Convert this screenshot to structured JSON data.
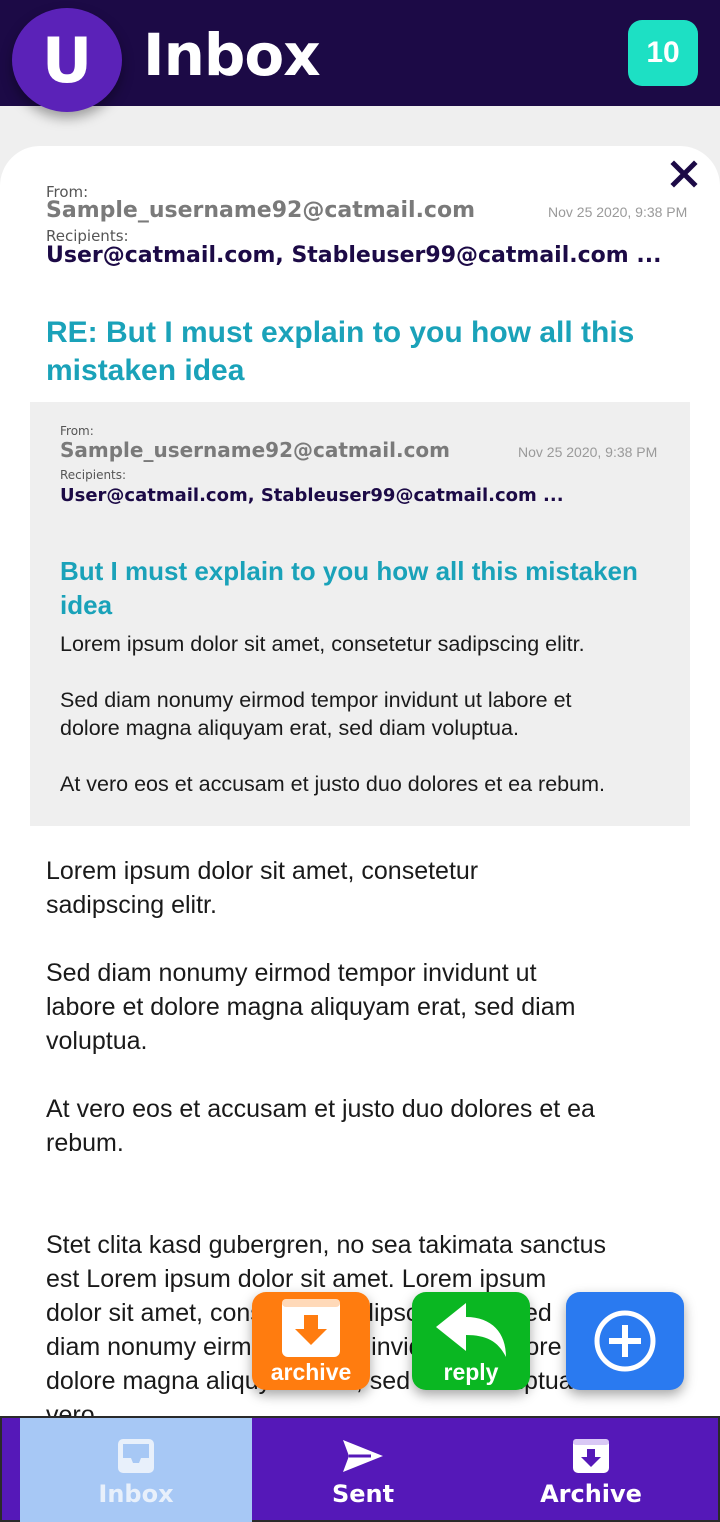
{
  "header": {
    "avatar_letter": "U",
    "title": "Inbox",
    "unread_count": "10"
  },
  "email": {
    "from_label": "From:",
    "from": "Sample_username92@catmail.com",
    "recipients_label": "Recipients:",
    "recipients": "User@catmail.com, Stableuser99@catmail.com ...",
    "date": "Nov 25 2020, 9:38 PM",
    "subject_line1": "RE: But I must explain to you how all this",
    "subject_line2": "mistaken idea",
    "quoted": {
      "from_label": "From:",
      "from": "Sample_username92@catmail.com",
      "recipients_label": "Recipients:",
      "recipients": "User@catmail.com, Stableuser99@catmail.com ...",
      "date": "Nov 25 2020, 9:38 PM",
      "subject_line1": "But I must explain to you how all this mistaken",
      "subject_line2": "idea",
      "body": [
        "Lorem ipsum dolor sit amet, consetetur sadipscing elitr.",
        "Sed diam nonumy eirmod tempor invidunt ut labore et",
        "dolore magna aliquyam erat, sed diam voluptua.",
        "At vero eos et accusam et justo duo dolores et ea rebum."
      ]
    },
    "body": [
      "Lorem ipsum dolor sit amet, consetetur",
      "sadipscing elitr.",
      "Sed diam nonumy eirmod tempor invidunt ut",
      "labore et dolore magna aliquyam erat, sed diam",
      "voluptua.",
      "At vero eos et accusam et justo duo dolores et ea",
      "rebum.",
      "Stet clita kasd gubergren, no sea takimata sanctus",
      "est Lorem ipsum dolor sit amet. Lorem ipsum",
      "dolor sit amet, consetetur sadipscing elitr, sed",
      "diam nonumy eirmod tempor invidunt ut labore et",
      "dolore magna aliquyam erat, sed diam voluptua. At",
      "vero"
    ]
  },
  "actions": {
    "archive_label": "archive",
    "reply_label": "reply"
  },
  "nav": {
    "items": [
      {
        "label": "Inbox",
        "icon": "inbox-icon",
        "active": true
      },
      {
        "label": "Sent",
        "icon": "send-icon",
        "active": false
      },
      {
        "label": "Archive",
        "icon": "archive-box-icon",
        "active": false
      }
    ]
  },
  "colors": {
    "header_bg": "#1c0a46",
    "avatar": "#5b22b8",
    "badge": "#1de0c4",
    "subject": "#1aa2b9",
    "archive_button": "#ff7c0f",
    "reply_button": "#0ab722",
    "compose_button": "#2a7af0",
    "nav_bg": "#5518b8",
    "nav_active": "#a7c8f5"
  }
}
